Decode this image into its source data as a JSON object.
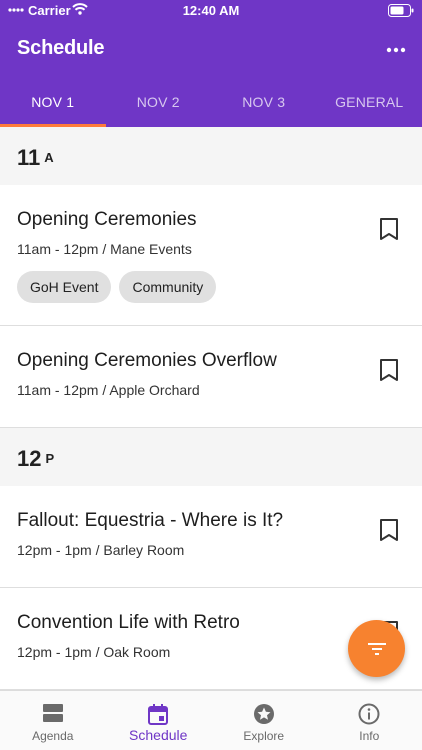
{
  "status_bar": {
    "carrier": "Carrier",
    "time": "12:40 AM"
  },
  "app_bar": {
    "title": "Schedule",
    "more_icon": "more-horizontal-icon"
  },
  "tabs": [
    {
      "label": "NOV 1",
      "active": true
    },
    {
      "label": "NOV 2",
      "active": false
    },
    {
      "label": "NOV 3",
      "active": false
    },
    {
      "label": "GENERAL",
      "active": false
    }
  ],
  "sections": [
    {
      "hour": "11",
      "ampm": "A",
      "events": [
        {
          "title": "Opening Ceremonies",
          "meta": "11am - 12pm / Mane Events",
          "tags": [
            "GoH Event",
            "Community"
          ]
        },
        {
          "title": "Opening Ceremonies Overflow",
          "meta": "11am - 12pm / Apple Orchard",
          "tags": []
        }
      ]
    },
    {
      "hour": "12",
      "ampm": "P",
      "events": [
        {
          "title": "Fallout: Equestria - Where is It?",
          "meta": "12pm - 1pm / Barley Room",
          "tags": []
        },
        {
          "title": "Convention Life with Retro",
          "meta": "12pm - 1pm / Oak Room",
          "tags": []
        }
      ]
    }
  ],
  "fab": {
    "icon": "filter-icon"
  },
  "bottom_nav": [
    {
      "label": "Agenda",
      "icon": "agenda-icon",
      "active": false
    },
    {
      "label": "Schedule",
      "icon": "calendar-icon",
      "active": true
    },
    {
      "label": "Explore",
      "icon": "star-icon",
      "active": false
    },
    {
      "label": "Info",
      "icon": "info-icon",
      "active": false
    }
  ],
  "colors": {
    "primary": "#6f36c6",
    "accent": "#f7822f",
    "tab_indicator": "#ff7a3a"
  }
}
